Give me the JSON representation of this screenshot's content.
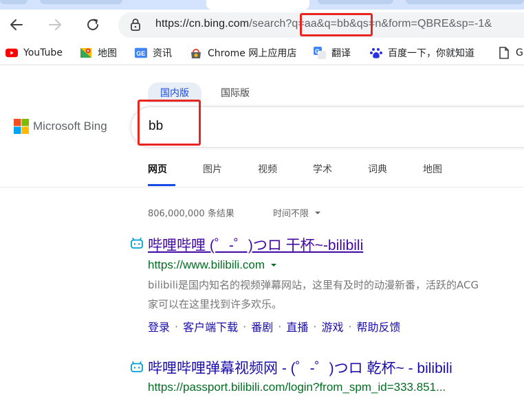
{
  "browser": {
    "url_host": "https://cn.bing.com",
    "url_path": "/search?q=aa&q=bb&qs=n&form=QBRE&sp=-1&"
  },
  "bookmarks": [
    {
      "label": "YouTube",
      "icon": "youtube-icon"
    },
    {
      "label": "地图",
      "icon": "maps-icon"
    },
    {
      "label": "资讯",
      "icon": "news-icon"
    },
    {
      "label": "Chrome 网上应用店",
      "icon": "chrome-store-icon"
    },
    {
      "label": "翻译",
      "icon": "translate-icon"
    },
    {
      "label": "百度一下，你就知道",
      "icon": "baidu-icon"
    },
    {
      "label": "G",
      "icon": "page-icon"
    }
  ],
  "bing": {
    "scope_tabs": [
      "国内版",
      "国际版"
    ],
    "logo_text": "Microsoft Bing",
    "query": "bb",
    "vertical_tabs": [
      "网页",
      "图片",
      "视频",
      "学术",
      "词典",
      "地图"
    ],
    "result_count": "806,000,000 条结果",
    "time_filter": "时间不限"
  },
  "results": [
    {
      "title": "哔哩哔哩 (゜-゜)つロ 干杯~-bilibili",
      "url": "https://www.bilibili.com",
      "snippet_line1": "bilibili是国内知名的视频弹幕网站，这里有及时的动漫新番，活跃的ACG",
      "snippet_line2": "家可以在这里找到许多欢乐。",
      "sitelinks": [
        "登录",
        "客户端下载",
        "番剧",
        "直播",
        "游戏",
        "帮助反馈"
      ]
    },
    {
      "title": "哔哩哔哩弹幕视频网 - (゜-゜)つロ 乾杯~ - bilibili",
      "url": "https://passport.bilibili.com/login?from_spm_id=333.851..."
    }
  ],
  "colors": {
    "highlight": "#e8251f",
    "bing_blue": "#174ae4",
    "visited_link": "#4007a2",
    "url_green": "#006d21"
  }
}
